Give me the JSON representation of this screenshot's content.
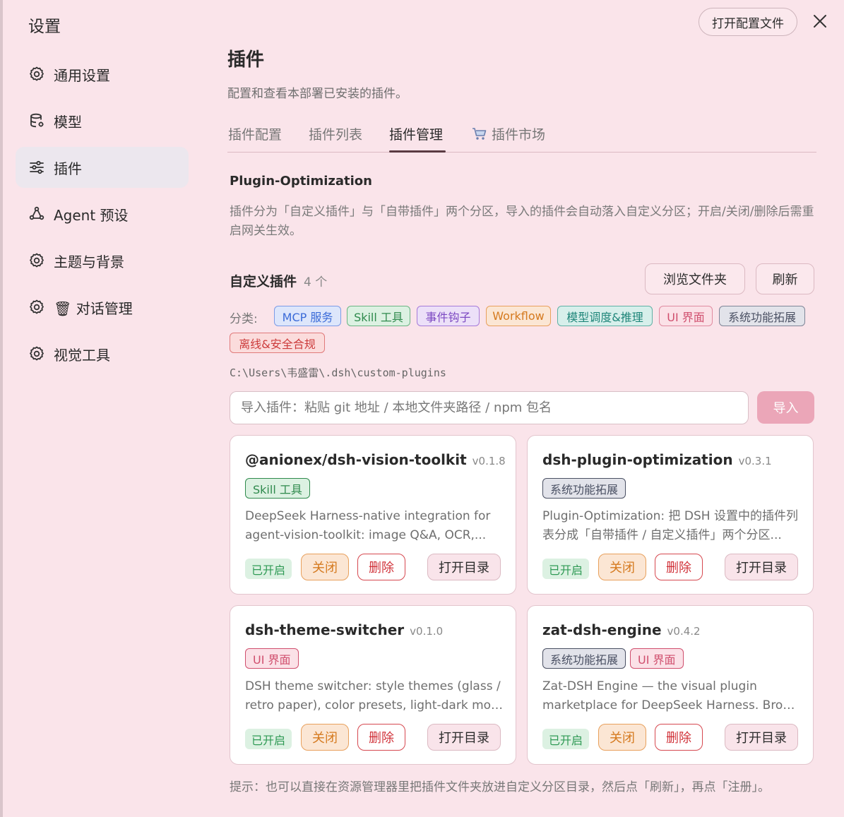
{
  "sidebar": {
    "title": "设置",
    "items": [
      {
        "label": "通用设置",
        "icon": "gear-icon"
      },
      {
        "label": "模型",
        "icon": "database-icon"
      },
      {
        "label": "插件",
        "icon": "sliders-icon",
        "active": true
      },
      {
        "label": "Agent 预设",
        "icon": "agent-icon"
      },
      {
        "label": "主题与背景",
        "icon": "gear-icon"
      },
      {
        "label": "🗑 对话管理",
        "icon": "gear-icon"
      },
      {
        "label": "视觉工具",
        "icon": "gear-icon"
      }
    ]
  },
  "header": {
    "open_config": "打开配置文件",
    "close_icon": "close-icon"
  },
  "main": {
    "title": "插件",
    "subtitle": "配置和查看本部署已安装的插件。",
    "tabs": [
      {
        "label": "插件配置"
      },
      {
        "label": "插件列表"
      },
      {
        "label": "插件管理",
        "active": true
      },
      {
        "label": "插件市场",
        "icon": "cart-icon"
      }
    ],
    "section_title": "Plugin-Optimization",
    "description": "插件分为「自定义插件」与「自带插件」两个分区，导入的插件会自动落入自定义分区；开启/关闭/删除后需重启网关生效。",
    "custom": {
      "title": "自定义插件",
      "count": "4 个",
      "browse": "浏览文件夹",
      "refresh": "刷新"
    },
    "categories": {
      "label": "分类:",
      "items": [
        "MCP 服务",
        "Skill 工具",
        "事件钩子",
        "Workflow",
        "模型调度&推理",
        "UI 界面",
        "系统功能拓展",
        "离线&安全合规"
      ]
    },
    "path": "C:\\Users\\韦盛雷\\.dsh\\custom-plugins",
    "import": {
      "placeholder": "导入插件：粘贴 git 地址 / 本地文件夹路径 / npm 包名",
      "button": "导入"
    },
    "plugins": [
      {
        "name": "@anionex/dsh-vision-toolkit",
        "version": "v0.1.8",
        "tags": [
          "Skill 工具"
        ],
        "desc1": "DeepSeek Harness-native integration for",
        "desc2": "agent-vision-toolkit: image Q&A, OCR,...",
        "status": "已开启",
        "close": "关闭",
        "delete": "删除",
        "open_dir": "打开目录"
      },
      {
        "name": "dsh-plugin-optimization",
        "version": "v0.3.1",
        "tags": [
          "系统功能拓展"
        ],
        "desc1": "Plugin-Optimization: 把 DSH 设置中的插件列",
        "desc2": "表分成「自带插件 / 自定义插件」两个分区...",
        "status": "已开启",
        "close": "关闭",
        "delete": "删除",
        "open_dir": "打开目录"
      },
      {
        "name": "dsh-theme-switcher",
        "version": "v0.1.0",
        "tags": [
          "UI 界面"
        ],
        "desc1": "DSH theme switcher: style themes (glass /",
        "desc2": "retro paper), color presets, light-dark mode...",
        "status": "已开启",
        "close": "关闭",
        "delete": "删除",
        "open_dir": "打开目录"
      },
      {
        "name": "zat-dsh-engine",
        "version": "v0.4.2",
        "tags": [
          "系统功能拓展",
          "UI 界面"
        ],
        "desc1": "Zat-DSH Engine — the visual plugin",
        "desc2": "marketplace for DeepSeek Harness. Browse,...",
        "status": "已开启",
        "close": "关闭",
        "delete": "删除",
        "open_dir": "打开目录"
      }
    ],
    "hint": "提示：也可以直接在资源管理器里把插件文件夹放进自定义分区目录，然后点「刷新」，再点「注册」。"
  }
}
